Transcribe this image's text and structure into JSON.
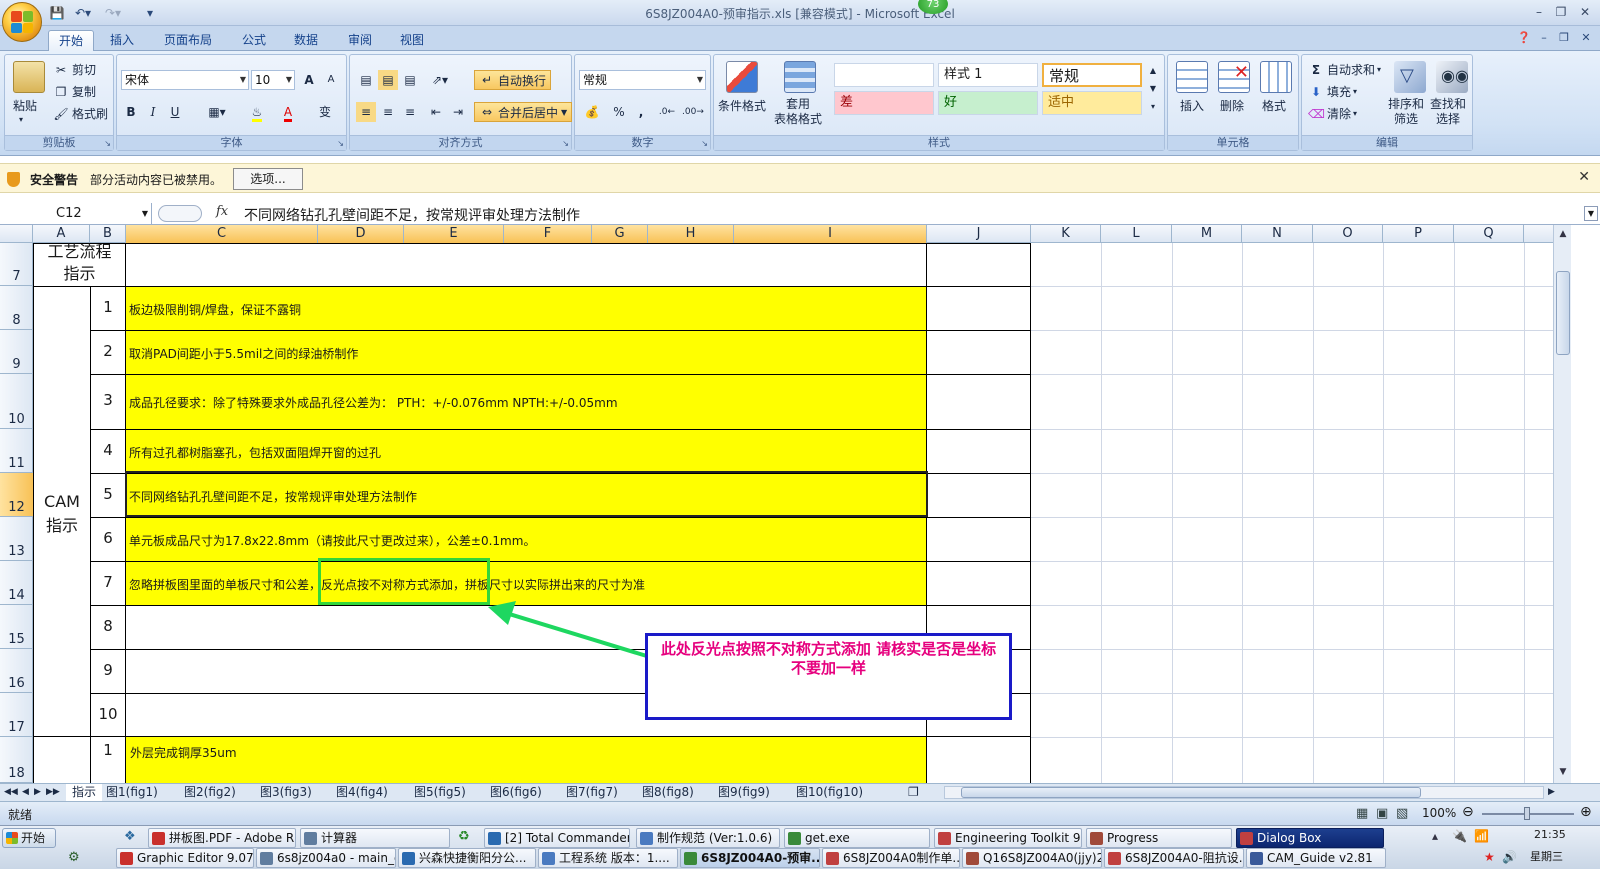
{
  "window": {
    "title": "6S8JZ004A0-预审指示.xls  [兼容模式] - Microsoft Excel",
    "notification_count": "73"
  },
  "ribbon": {
    "tabs": [
      "开始",
      "插入",
      "页面布局",
      "公式",
      "数据",
      "审阅",
      "视图"
    ],
    "active_tab": "开始",
    "clipboard": {
      "paste": "粘贴",
      "cut": "剪切",
      "copy": "复制",
      "format_painter": "格式刷",
      "label": "剪贴板"
    },
    "font": {
      "name": "宋体",
      "size": "10",
      "label": "字体",
      "bold": "B",
      "italic": "I",
      "underline": "U",
      "grow": "A",
      "shrink": "A"
    },
    "alignment": {
      "wrap_text": "自动换行",
      "merge_center": "合并后居中",
      "label": "对齐方式"
    },
    "number": {
      "format": "常规",
      "percent": "%",
      "comma": ",",
      "label": "数字"
    },
    "styles": {
      "conditional": "条件格式",
      "as_table": "套用\n表格格式",
      "cells": [
        "",
        "样式 1",
        "常规",
        "差",
        "好",
        "适中"
      ],
      "label": "样式"
    },
    "cells": {
      "insert": "插入",
      "delete": "删除",
      "format": "格式",
      "label": "单元格"
    },
    "editing": {
      "autosum": "自动求和",
      "fill": "填充",
      "clear": "清除",
      "sort_filter": "排序和\n筛选",
      "find_select": "查找和\n选择",
      "label": "编辑"
    }
  },
  "security_bar": {
    "title": "安全警告",
    "message": "部分活动内容已被禁用。",
    "options_button": "选项..."
  },
  "formula_bar": {
    "name_box": "C12",
    "fx": "fx",
    "content": "不同网络钻孔孔壁间距不足，按常规评审处理方法制作"
  },
  "columns": [
    "A",
    "B",
    "C",
    "D",
    "E",
    "F",
    "G",
    "H",
    "I",
    "J",
    "K",
    "L",
    "M",
    "N",
    "O",
    "P",
    "Q"
  ],
  "rows": [
    "7",
    "8",
    "9",
    "10",
    "11",
    "12",
    "13",
    "14",
    "15",
    "16",
    "17",
    "18"
  ],
  "sheet": {
    "section1_title": "工艺流程\n指示",
    "section2_title": "CAM\n指示",
    "items": [
      {
        "no": "1",
        "text": "板边极限削铜/焊盘，保证不露铜"
      },
      {
        "no": "2",
        "text": "取消PAD间距小于5.5mil之间的绿油桥制作"
      },
      {
        "no": "3",
        "text": "成品孔径要求：除了特殊要求外成品孔径公差为： PTH：+/-0.076mm    NPTH:+/-0.05mm"
      },
      {
        "no": "4",
        "text": "所有过孔都树脂塞孔，包括双面阻焊开窗的过孔"
      },
      {
        "no": "5",
        "text": "不同网络钻孔孔壁间距不足，按常规评审处理方法制作"
      },
      {
        "no": "6",
        "text": "单元板成品尺寸为17.8x22.8mm（请按此尺寸更改过来），公差±0.1mm。"
      },
      {
        "no": "7",
        "text": "忽略拼板图里面的单板尺寸和公差，反光点按不对称方式添加，拼板尺寸以实际拼出来的尺寸为准"
      },
      {
        "no": "8",
        "text": ""
      },
      {
        "no": "9",
        "text": ""
      },
      {
        "no": "10",
        "text": ""
      }
    ],
    "row18": {
      "no": "1",
      "text": "外层完成铜厚35um"
    },
    "annotation": "此处反光点按照不对称方式添加    请核实是否是坐标不要加一样"
  },
  "sheet_tabs": [
    "指示",
    "图1(fig1)",
    "图2(fig2)",
    "图3(fig3)",
    "图4(fig4)",
    "图5(fig5)",
    "图6(fig6)",
    "图7(fig7)",
    "图8(fig8)",
    "图9(fig9)",
    "图10(fig10)"
  ],
  "status": {
    "ready": "就绪",
    "zoom": "100%"
  },
  "taskbar": {
    "start": "开始",
    "row1": [
      "拼板图.PDF - Adobe R...",
      "计算器",
      "[2] Total Commander 7...",
      "制作规范 (Ver:1.0.6)",
      "get.exe",
      "Engineering Toolkit 9.0...",
      "Progress",
      "Dialog Box"
    ],
    "row2": [
      "Graphic Editor 9.07b...",
      "6s8jz004a0 - main_ga",
      "兴森快捷衡阳分公...",
      "工程系统  版本：1....",
      "6S8JZ004A0-预审...",
      "6S8JZ004A0制作单....",
      "Q16S8JZ004A0(jjy)2...",
      "6S8JZ004A0-阻抗设...",
      "CAM_Guide v2.81"
    ],
    "time": "21:35",
    "day": "星期三"
  },
  "colors": {
    "highlight_yellow": "#ffff00",
    "annotation_text": "#e6007e",
    "annotation_border": "#1a1ac8",
    "arrow_green": "#1ed760"
  }
}
